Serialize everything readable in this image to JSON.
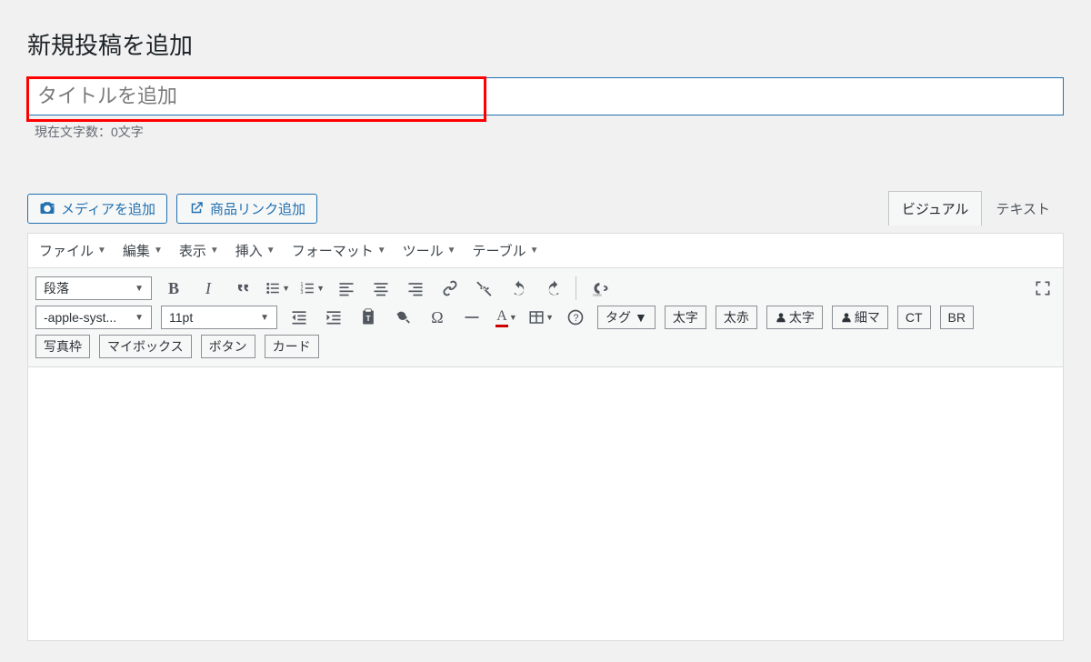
{
  "page": {
    "title": "新規投稿を追加"
  },
  "title_field": {
    "placeholder": "タイトルを追加",
    "value": ""
  },
  "char_counter": "現在文字数：0文字",
  "primary_buttons": {
    "add_media": "メディアを追加",
    "add_product_link": "商品リンク追加"
  },
  "editor_tabs": {
    "visual": "ビジュアル",
    "text": "テキスト"
  },
  "menubar": {
    "file": "ファイル",
    "edit": "編集",
    "view": "表示",
    "insert": "挿入",
    "format": "フォーマット",
    "tools": "ツール",
    "table": "テーブル"
  },
  "selects": {
    "paragraph": "段落",
    "fontfamily": "-apple-syst...",
    "fontsize": "11pt"
  },
  "tag_dropdown": "タグ",
  "text_buttons": {
    "futoji": "太字",
    "futoaka": "太赤",
    "person_futoji": "太字",
    "person_hosoma": "細マ",
    "ct": "CT",
    "br": "BR",
    "photo_frame": "写真枠",
    "mybox": "マイボックス",
    "button": "ボタン",
    "card": "カード"
  },
  "colors": {
    "text_color_underline": "#cc0000"
  }
}
